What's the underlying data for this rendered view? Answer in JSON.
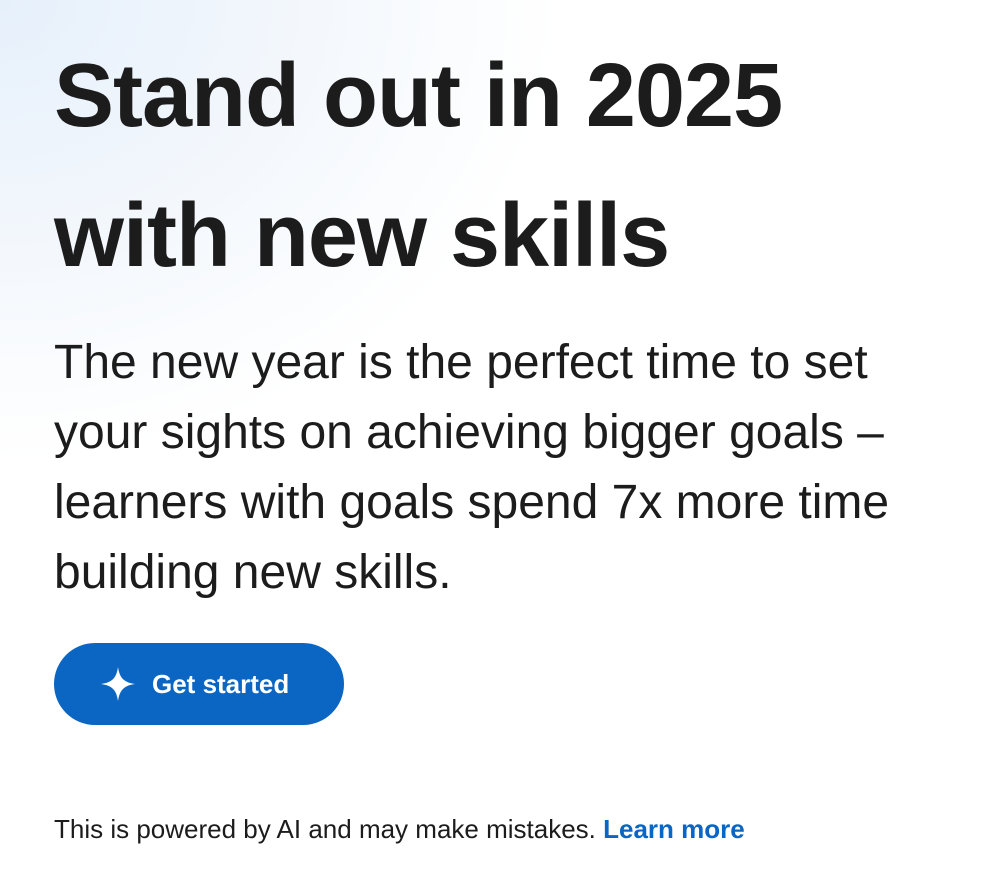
{
  "hero": {
    "title_lines": [
      "Stand out in 2025",
      "with new skills"
    ],
    "description_lines": [
      "The new year is the perfect time to set",
      "your sights on achieving bigger goals –",
      "learners with goals spend 7x more time",
      "building new skills."
    ]
  },
  "cta": {
    "label": "Get started",
    "icon": "sparkle-icon"
  },
  "disclaimer": {
    "text": "This is powered by AI and may make mistakes.",
    "link_label": "Learn more"
  },
  "colors": {
    "accent": "#0a66c2",
    "text": "#1c1c1c",
    "background": "#ffffff",
    "background_tint": "#e6f0fb"
  }
}
